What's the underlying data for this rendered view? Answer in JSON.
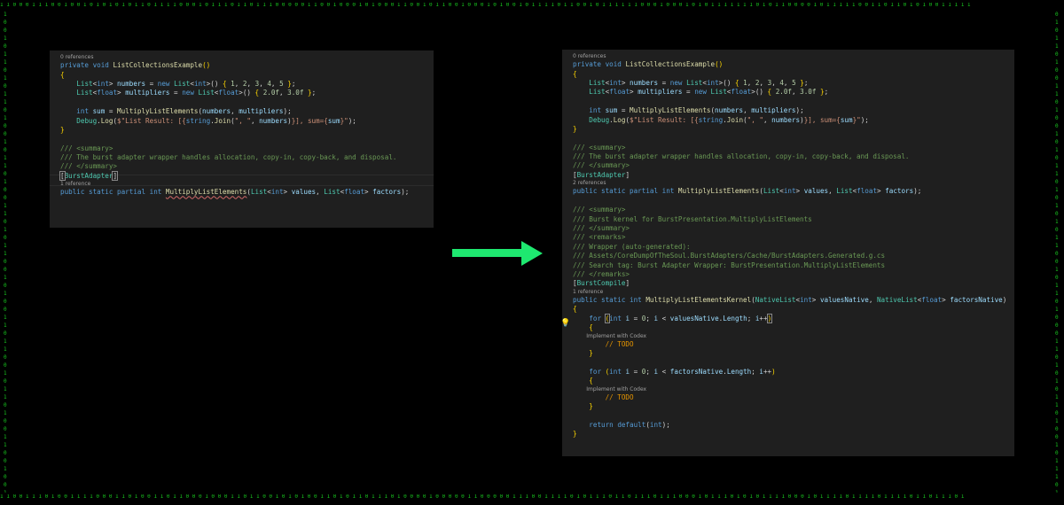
{
  "border": {
    "top": "1 1 0 0 0 1 1 1 0 0 1 0 0 1 0 1 0 1 0 1 0 1 1 0 1 1 1 1 0 0 0 1 0 1 1 1 0 1 1 0 1 1 1 0 0 0 0 0 1 1 0 0 1 0 0 0 1 0 1 0 0 0 1 1 0 0 1 0 1 1 0 0 1 0 0 0 1 0 1 0 0 1 0 1 1 1 1 0 1 1 0 0 1 0 1 1 1 1 1 1 0 0 0 1 0 0 0 1 0 1 0 1 1 1 1 1 1 1 0 1 0 1 1 0 0 0 0 1 0 1 1 1 1 1 0 0 1 1 0 1 1 0 1 0 1 0 0 1 1 1 1 1",
    "bottom": "1 1 0 0 1 1 1 0 1 0 0 1 1 1 1 0 0 0 1 1 0 1 0 0 1 1 0 1 1 0 0 0 1 0 0 0 1 1 0 1 1 0 0 1 0 1 0 1 0 0 1 1 0 1 0 1 1 0 1 1 1 0 1 0 0 0 0 1 0 0 0 0 0 1 1 0 0 0 0 0 1 1 1 0 0 1 1 1 1 0 1 0 1 1 1 0 1 1 0 1 1 1 0 1 1 1 0 0 0 1 0 1 1 1 0 1 0 1 0 1 1 1 1 0 0 0 1 0 1 1 1 1 0 1 1 1 1 0 1 1 1 1 0 1 1 0 1 1 1 0 1",
    "left": "1 0 0 1 0 1 1 0 1 0 1 1 0 1 0 0 1 0 1 1 0 1 0 0 1 1 0 1 0 1 1 0 0 1 0 1 0 0 1 1 0 1 1 0 0 1 0 1 1 0 1 0 0 1 1 0 0 1 0 0 1",
    "right": "0 1 0 1 1 0 1 0 0 1 1 0 1 0 0 1 0 1 0 1 1 0 1 0 1 0 1 0 1 1 0 0 1 0 1 1 0 1 0 0 0 1 1 0 1 0 1 0 1 1 0 1 0 0 1 0 1 1 1 0 1"
  },
  "hints": {
    "zero_refs": "0 references",
    "one_ref": "1 reference",
    "two_refs": "2 references",
    "codex": "Implement with Codex"
  },
  "code": {
    "k_private": "private",
    "k_void": "void",
    "k_public": "public",
    "k_static": "static",
    "k_partial": "partial",
    "k_int": "int",
    "k_new": "new",
    "k_for": "for",
    "k_return": "return",
    "k_default": "default",
    "k_string": "string",
    "fn_example": "ListCollectionsExample",
    "fn_multiply": "MultiplyListElements",
    "fn_kernel": "MultiplyListElementsKernel",
    "fn_debug": "Debug",
    "fn_log": "Log",
    "fn_join": "Join",
    "ty_list": "List",
    "ty_native": "NativeList",
    "ty_float": "float",
    "id_numbers": "numbers",
    "id_multipliers": "multipliers",
    "id_sum": "sum",
    "id_values": "values",
    "id_factors": "factors",
    "id_valuesNative": "valuesNative",
    "id_factorsNative": "factorsNative",
    "id_i": "i",
    "id_length": "Length",
    "attr_adapter": "BurstAdapter",
    "attr_compile": "BurstCompile",
    "n1": "1",
    "n2": "2",
    "n3": "3",
    "n4": "4",
    "n5": "5",
    "n0": "0",
    "f20": "2.0f",
    "f30": "3.0f",
    "str_prefix": "$\"List Result: [{",
    "str_sep": "\", \"",
    "str_mid": "}], sum={",
    "str_end": "}\"",
    "cm_summary_open": "/// <summary>",
    "cm_summary_close": "/// </summary>",
    "cm_wrapper_desc": "/// The burst adapter wrapper handles allocation, copy-in, copy-back, and disposal.",
    "cm_kernel_desc": "/// Burst kernel for BurstPresentation.MultiplyListElements",
    "cm_remarks_open": "/// <remarks>",
    "cm_remarks_close": "/// </remarks>",
    "cm_wrapper": "/// Wrapper (auto-generated):",
    "cm_path": "/// Assets/CoreDumpOfTheSoul.BurstAdapters/Cache/BurstAdapters.Generated.g.cs",
    "cm_search": "/// Search tag: Burst Adapter Wrapper: BurstPresentation.MultiplyListElements",
    "todo": "// TODO"
  },
  "colors": {
    "keyword": "#569cd6",
    "type": "#4ec9b0",
    "function": "#dcdcaa",
    "identifier": "#9cdcfe",
    "string": "#ce9178",
    "number": "#b5cea8",
    "comment": "#6a9955",
    "arrow": "#1ee870",
    "matrix": "#18c41f",
    "panel": "#1f1f1f"
  },
  "icons": {
    "arrow": "right-arrow-icon",
    "bulb": "lightbulb-icon"
  }
}
